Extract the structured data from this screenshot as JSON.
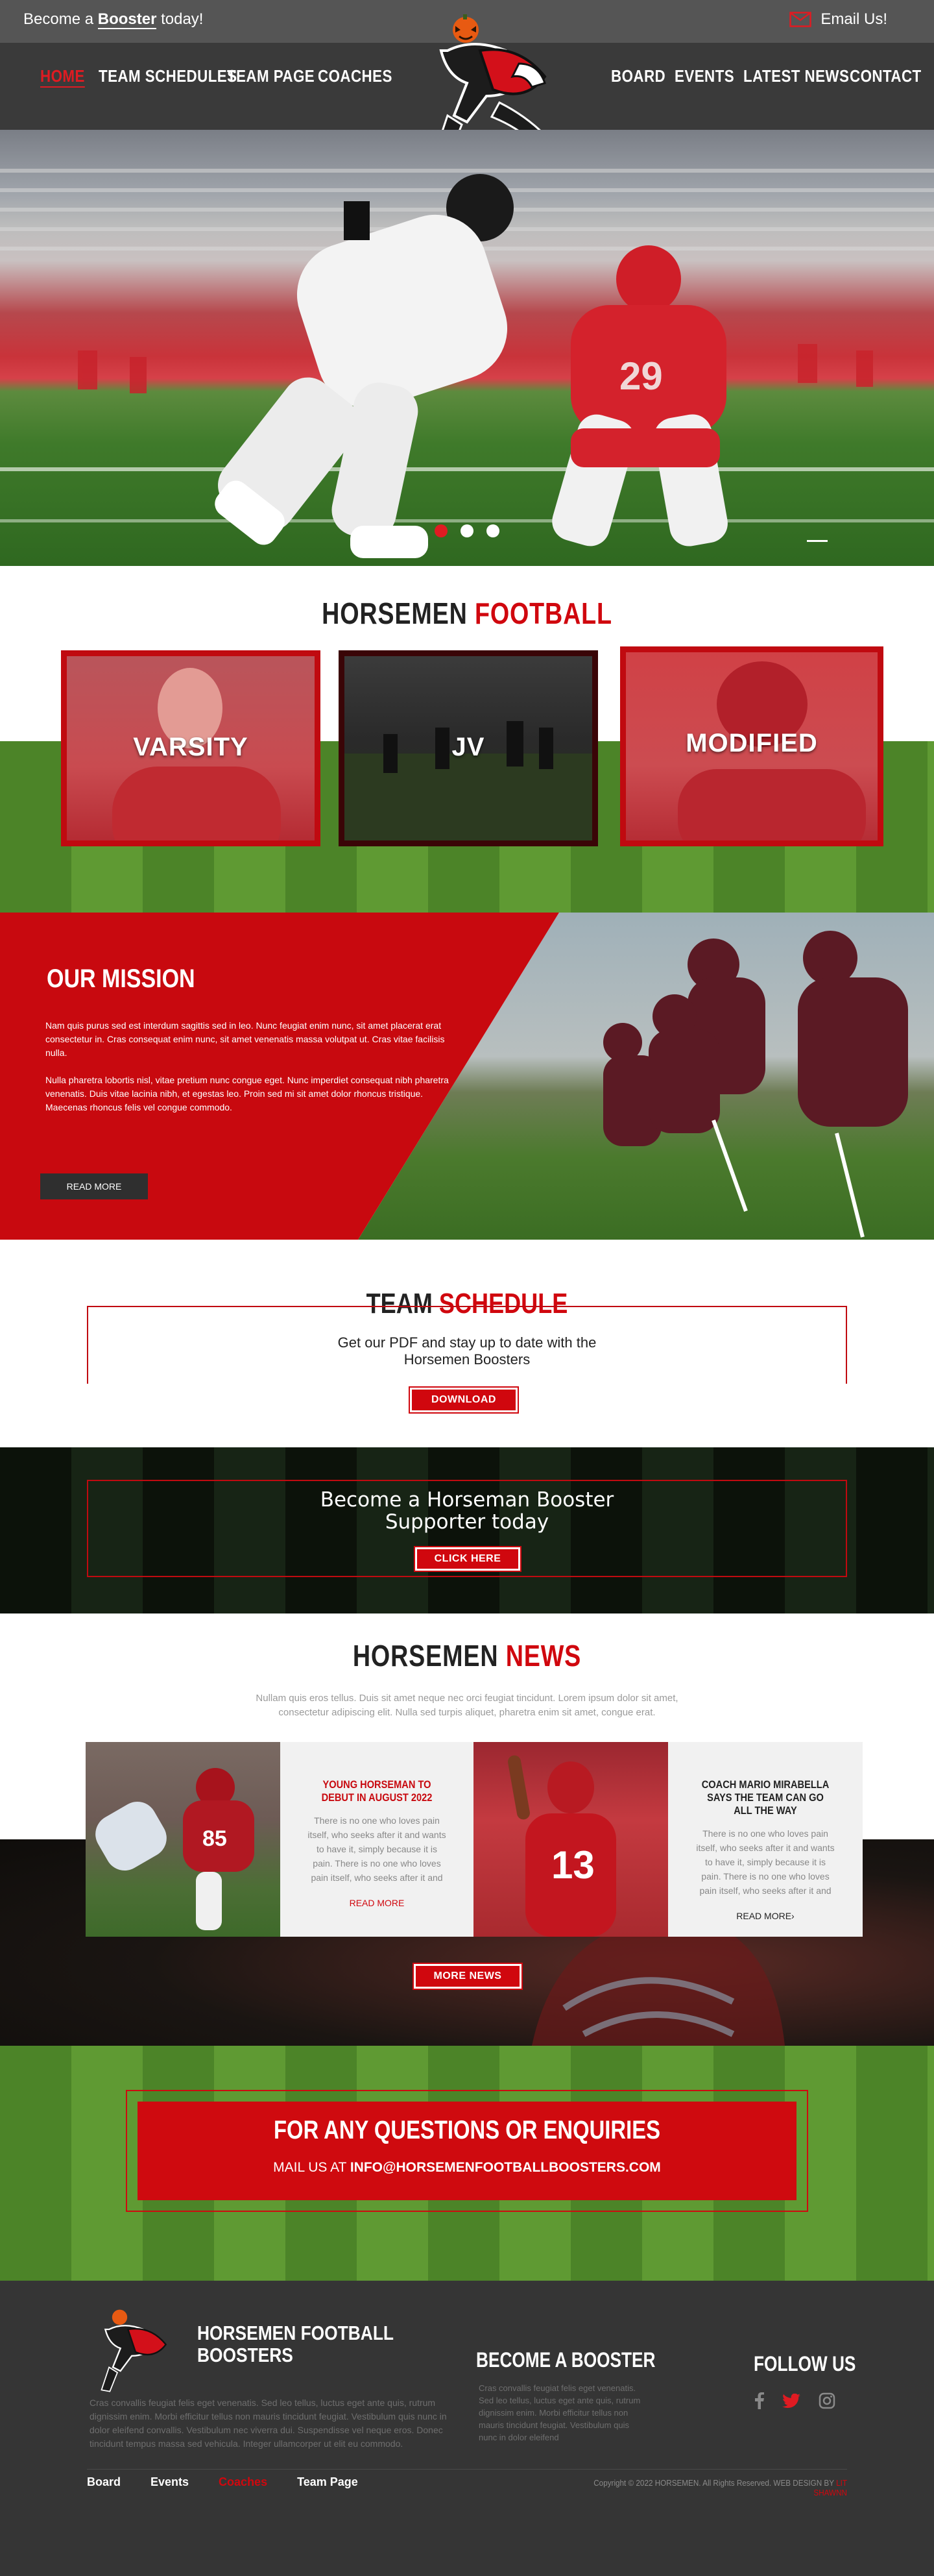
{
  "topbar": {
    "promo_pre": "Become a ",
    "promo_bold": "Booster",
    "promo_post": " today!",
    "email_label": "Email Us!"
  },
  "nav": {
    "left": [
      "HOME",
      "TEAM SCHEDULES",
      "TEAM PAGE",
      "COACHES"
    ],
    "right": [
      "BOARD",
      "EVENTS",
      "LATEST NEWS",
      "CONTACT"
    ],
    "active": "HOME"
  },
  "hero": {
    "slides": 3,
    "active_slide": 0
  },
  "teams": {
    "title_a": "HORSEMEN",
    "title_b": "FOOTBALL",
    "cards": [
      {
        "label": "VARSITY"
      },
      {
        "label": "JV"
      },
      {
        "label": "MODIFIED"
      }
    ]
  },
  "mission": {
    "title": "OUR MISSION",
    "p1": "Nam quis purus sed est interdum sagittis sed in leo. Nunc feugiat enim nunc, sit amet placerat erat consectetur in. Cras consequat enim nunc, sit amet venenatis massa volutpat ut. Cras vitae facilisis nulla.",
    "p2": "Nulla pharetra lobortis nisl, vitae pretium nunc congue eget. Nunc imperdiet consequat nibh pharetra venenatis. Duis vitae lacinia nibh, et egestas leo. Proin sed mi sit amet dolor rhoncus tristique. Maecenas rhoncus felis vel congue commodo.",
    "button": "READ MORE"
  },
  "schedule": {
    "title_a": "TEAM",
    "title_b": "SCHEDULE",
    "line1": "Get our PDF and stay up to date with the",
    "line2": "Horsemen Boosters",
    "button": "DOWNLOAD"
  },
  "booster": {
    "line1": "Become a Horseman Booster",
    "line2": "Supporter today",
    "button": "CLICK HERE"
  },
  "news": {
    "title_a": "HORSEMEN",
    "title_b": "NEWS",
    "intro1": "Nullam quis eros tellus. Duis sit amet neque nec orci feugiat tincidunt. Lorem ipsum dolor sit amet,",
    "intro2": "consectetur adipiscing elit. Nulla sed turpis aliquet, pharetra enim sit amet, congue erat.",
    "items": [
      {
        "title": "YOUNG HORSEMAN TO DEBUT IN AUGUST 2022",
        "body": "There is no one who loves pain itself, who seeks after it and wants to have it, simply because it is pain. There is no one who loves pain itself, who seeks after it and",
        "link": "READ MORE"
      },
      {
        "title": "COACH MARIO MIRABELLA SAYS THE TEAM CAN GO ALL THE WAY",
        "body": "There is no one who loves pain itself, who seeks after it and wants to have it, simply because it is pain. There is no one who loves pain itself, who seeks after it and",
        "link": "READ MORE›"
      }
    ],
    "button": "MORE NEWS"
  },
  "contact": {
    "title": "FOR ANY QUESTIONS OR ENQUIRIES",
    "mail_pre": "MAIL US AT ",
    "mail": "INFO@HORSEMENFOOTBALLBOOSTERS.COM"
  },
  "footer": {
    "brand1": "HORSEMEN FOOTBALL",
    "brand2": "BOOSTERS",
    "about": "Cras convallis feugiat felis eget venenatis. Sed leo tellus, luctus eget ante quis, rutrum dignissim enim. Morbi efficitur tellus non mauris tincidunt feugiat. Vestibulum quis nunc in dolor eleifend convallis. Vestibulum nec viverra dui. Suspendisse vel neque eros. Donec tincidunt tempus massa sed vehicula. Integer ullamcorper ut elit eu commodo.",
    "booster_title": "BECOME A BOOSTER",
    "booster_text": "Cras convallis feugiat felis eget venenatis. Sed leo tellus, luctus eget ante quis, rutrum dignissim enim. Morbi efficitur tellus non mauris tincidunt feugiat. Vestibulum quis nunc in dolor eleifend",
    "follow_title": "FOLLOW US",
    "links": [
      "Board",
      "Events",
      "Coaches",
      "Team Page"
    ],
    "active_link": "Coaches",
    "copyright": "Copyright © 2022 HORSEMEN. All Rights Reserved. WEB DESIGN BY",
    "designer": "LIT SHAWNN"
  },
  "colors": {
    "brand_red": "#c8090f",
    "dark": "#353535",
    "grass": "#5f9a33"
  }
}
